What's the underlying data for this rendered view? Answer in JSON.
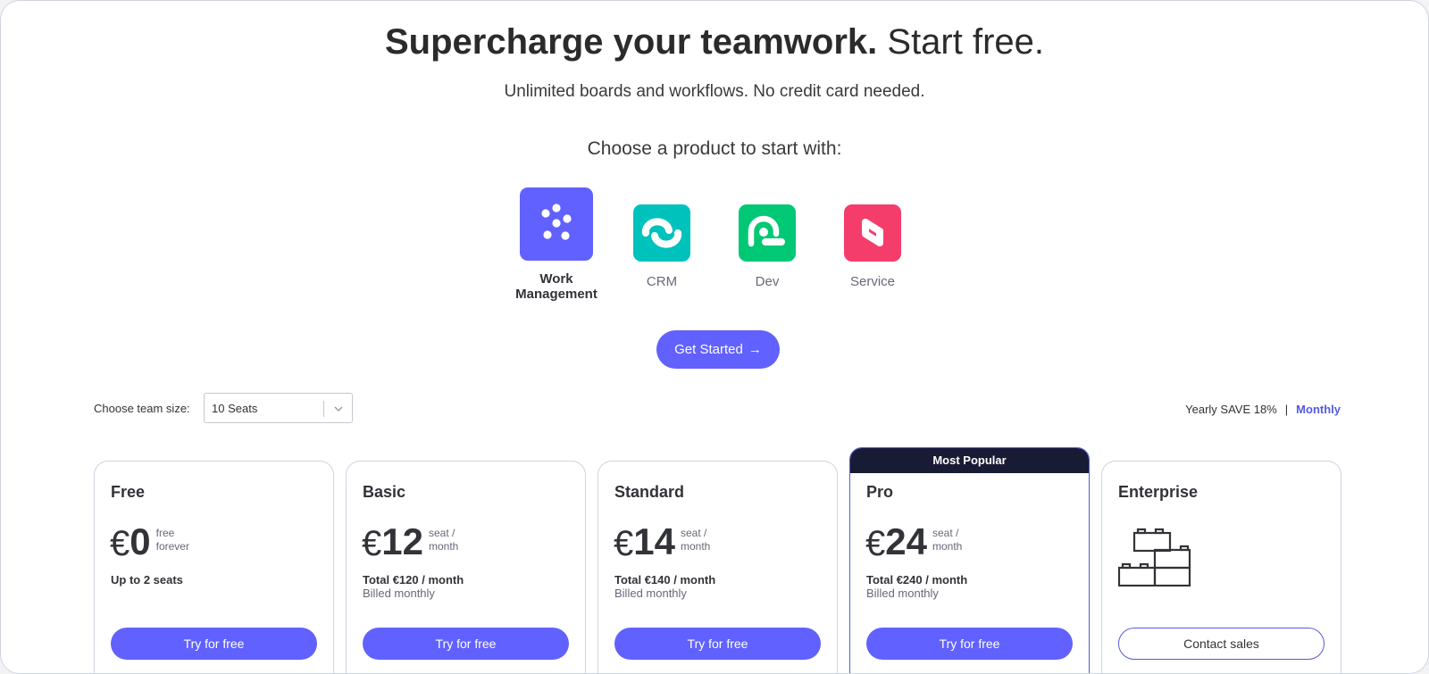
{
  "hero": {
    "title_strong": "Supercharge your teamwork.",
    "title_light": "Start free.",
    "subtitle": "Unlimited boards and workflows. No credit card needed."
  },
  "products": {
    "heading": "Choose a product to start with:",
    "items": [
      {
        "label_line1": "Work",
        "label_line2": "Management",
        "icon": "work-management-dots-icon",
        "color": "#6161ff",
        "selected": true
      },
      {
        "label": "CRM",
        "icon": "crm-icon",
        "color": "#00c2bd"
      },
      {
        "label": "Dev",
        "icon": "dev-icon",
        "color": "#00c875"
      },
      {
        "label": "Service",
        "icon": "service-icon",
        "color": "#f53d6b"
      }
    ]
  },
  "cta": {
    "label": "Get Started",
    "arrow": "→",
    "color": "#6161ff"
  },
  "team": {
    "label": "Choose team size:",
    "value": "10 Seats",
    "icon": "chevron-down-icon"
  },
  "billing": {
    "yearly": "Yearly SAVE 18%",
    "separator": "|",
    "monthly": "Monthly",
    "active_color": "#5559df"
  },
  "plans": [
    {
      "name": "Free",
      "currency": "€",
      "price": "0",
      "unit_line1": "free",
      "unit_line2": "forever",
      "total": "Up to 2 seats",
      "billed": "",
      "button": "Try for free"
    },
    {
      "name": "Basic",
      "currency": "€",
      "price": "12",
      "unit_line1": "seat /",
      "unit_line2": "month",
      "total": "Total €120  / month",
      "billed": "Billed monthly",
      "button": "Try for free"
    },
    {
      "name": "Standard",
      "currency": "€",
      "price": "14",
      "unit_line1": "seat /",
      "unit_line2": "month",
      "total": "Total €140  / month",
      "billed": "Billed monthly",
      "button": "Try for free"
    },
    {
      "name": "Pro",
      "badge": "Most Popular",
      "currency": "€",
      "price": "24",
      "unit_line1": "seat /",
      "unit_line2": "month",
      "total": "Total €240  / month",
      "billed": "Billed monthly",
      "button": "Try for free"
    },
    {
      "name": "Enterprise",
      "icon": "building-blocks-icon",
      "button": "Contact sales"
    }
  ],
  "colors": {
    "primary": "#6161ff",
    "dark_banner": "#181b34",
    "text": "#323338",
    "muted": "#676879"
  }
}
